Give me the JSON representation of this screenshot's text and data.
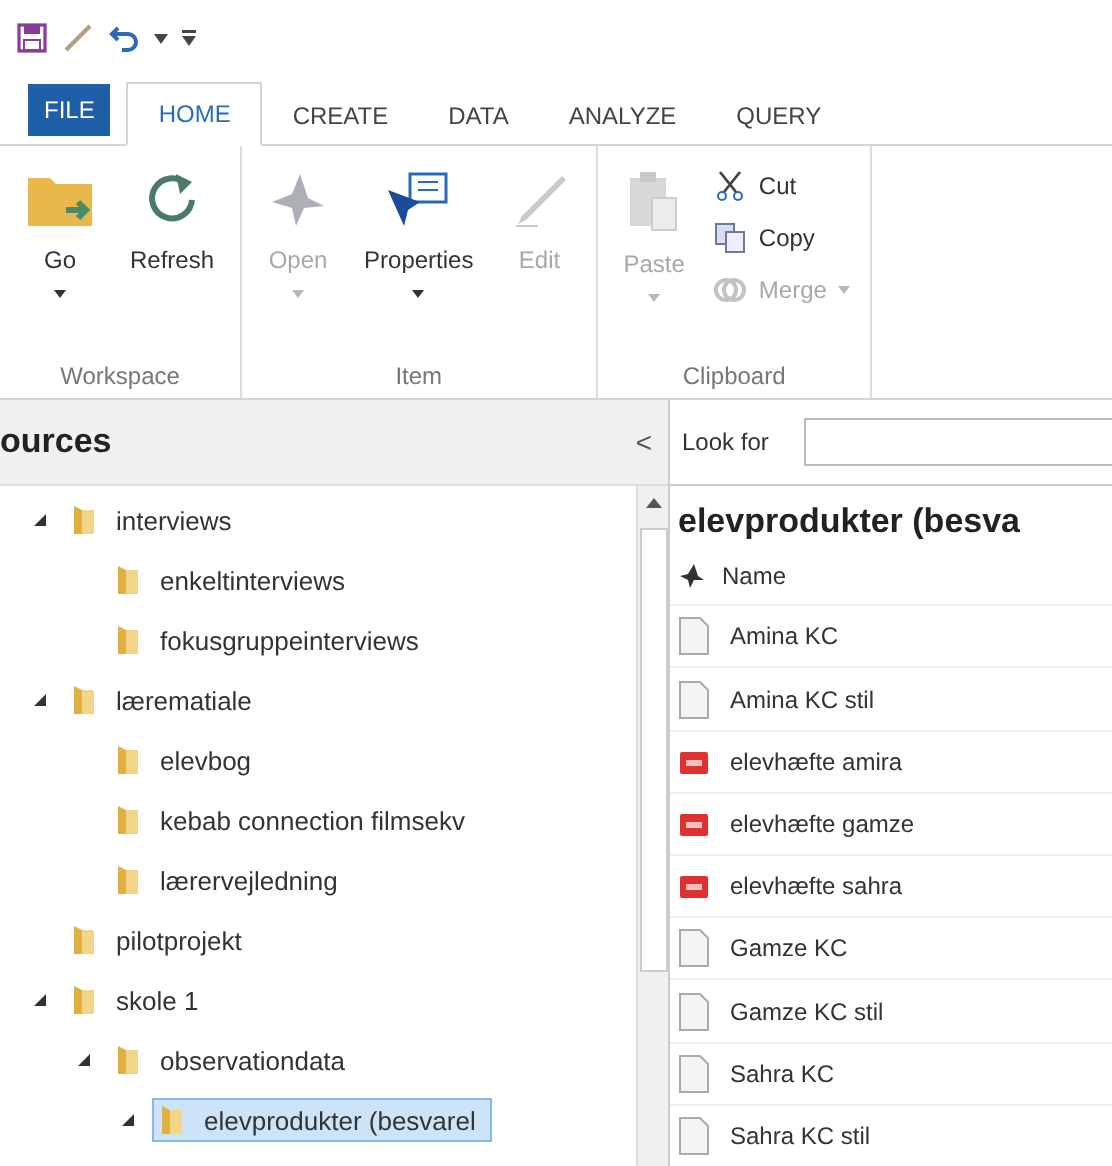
{
  "tabs": [
    {
      "label": "FILE",
      "kind": "file",
      "selected": false
    },
    {
      "label": "HOME",
      "kind": "tab",
      "selected": true
    },
    {
      "label": "CREATE",
      "kind": "tab",
      "selected": false
    },
    {
      "label": "DATA",
      "kind": "tab",
      "selected": false
    },
    {
      "label": "ANALYZE",
      "kind": "tab",
      "selected": false
    },
    {
      "label": "QUERY",
      "kind": "tab",
      "selected": false
    }
  ],
  "ribbon": {
    "groups": [
      {
        "label": "Workspace",
        "commands": [
          {
            "label": "Go",
            "kind": "large",
            "disabled": false,
            "dropdown": true
          },
          {
            "label": "Refresh",
            "kind": "large",
            "disabled": false,
            "dropdown": false
          }
        ]
      },
      {
        "label": "Item",
        "commands": [
          {
            "label": "Open",
            "kind": "large",
            "disabled": true,
            "dropdown": true
          },
          {
            "label": "Properties",
            "kind": "large",
            "disabled": false,
            "dropdown": true
          },
          {
            "label": "Edit",
            "kind": "large",
            "disabled": true,
            "dropdown": false
          }
        ]
      },
      {
        "label": "Clipboard",
        "commands": [
          {
            "label": "Paste",
            "kind": "large",
            "disabled": true,
            "dropdown": true
          },
          {
            "label": "Cut",
            "kind": "small",
            "disabled": false,
            "dropdown": false
          },
          {
            "label": "Copy",
            "kind": "small",
            "disabled": false,
            "dropdown": false
          },
          {
            "label": "Merge",
            "kind": "small",
            "disabled": true,
            "dropdown": true
          }
        ]
      }
    ]
  },
  "sources": {
    "title": "ources",
    "collapse": "<",
    "tree": [
      {
        "label": "interviews",
        "expanded": true,
        "selected": false,
        "children": [
          {
            "label": "enkeltinterviews",
            "selected": false
          },
          {
            "label": "fokusgruppeinterviews",
            "selected": false
          }
        ]
      },
      {
        "label": "lærematiale",
        "expanded": true,
        "selected": false,
        "children": [
          {
            "label": "elevbog",
            "selected": false
          },
          {
            "label": "kebab connection filmsekv",
            "selected": false
          },
          {
            "label": "lærervejledning",
            "selected": false
          }
        ]
      },
      {
        "label": "pilotprojekt",
        "selected": false
      },
      {
        "label": "skole 1",
        "expanded": true,
        "selected": false,
        "children": [
          {
            "label": "observationdata",
            "expanded": true,
            "selected": false,
            "children": [
              {
                "label": "elevprodukter (besvarel",
                "expanded": true,
                "selected": true
              }
            ]
          }
        ]
      }
    ]
  },
  "list": {
    "look_for_label": "Look for",
    "title": "elevprodukter (besva",
    "column": "Name",
    "rows": [
      {
        "name": "Amina KC",
        "kind": "doc"
      },
      {
        "name": "Amina KC stil",
        "kind": "doc"
      },
      {
        "name": "elevhæfte amira",
        "kind": "pdf"
      },
      {
        "name": "elevhæfte gamze",
        "kind": "pdf"
      },
      {
        "name": "elevhæfte sahra",
        "kind": "pdf"
      },
      {
        "name": "Gamze KC",
        "kind": "doc"
      },
      {
        "name": "Gamze KC stil",
        "kind": "doc"
      },
      {
        "name": "Sahra KC",
        "kind": "doc"
      },
      {
        "name": "Sahra KC stil",
        "kind": "doc"
      }
    ]
  }
}
